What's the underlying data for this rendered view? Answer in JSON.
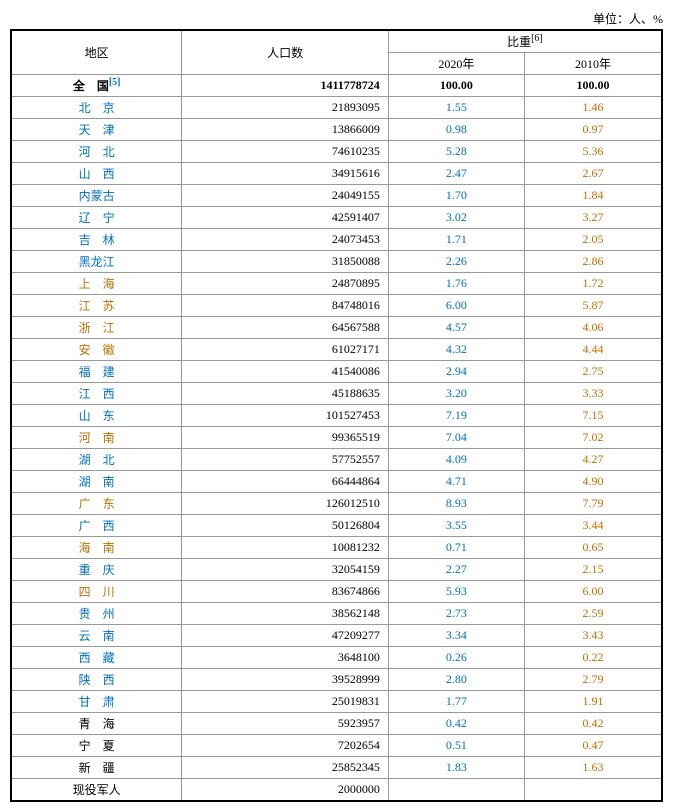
{
  "unit": "单位：人、%",
  "headers": {
    "region": "地区",
    "population": "人口数",
    "ratio_group": "比重",
    "ratio_note": "[6]",
    "year2020": "2020年",
    "year2010": "2010年"
  },
  "rows": [
    {
      "region": "全　国",
      "note": "[5]",
      "population": "1411778724",
      "r2020": "100.00",
      "r2010": "100.00",
      "bold": true
    },
    {
      "region": "北　京",
      "note": "",
      "population": "21893095",
      "r2020": "1.55",
      "r2010": "1.46",
      "bold": false
    },
    {
      "region": "天　津",
      "note": "",
      "population": "13866009",
      "r2020": "0.98",
      "r2010": "0.97",
      "bold": false
    },
    {
      "region": "河　北",
      "note": "",
      "population": "74610235",
      "r2020": "5.28",
      "r2010": "5.36",
      "bold": false
    },
    {
      "region": "山　西",
      "note": "",
      "population": "34915616",
      "r2020": "2.47",
      "r2010": "2.67",
      "bold": false
    },
    {
      "region": "内蒙古",
      "note": "",
      "population": "24049155",
      "r2020": "1.70",
      "r2010": "1.84",
      "bold": false
    },
    {
      "region": "辽　宁",
      "note": "",
      "population": "42591407",
      "r2020": "3.02",
      "r2010": "3.27",
      "bold": false
    },
    {
      "region": "吉　林",
      "note": "",
      "population": "24073453",
      "r2020": "1.71",
      "r2010": "2.05",
      "bold": false
    },
    {
      "region": "黑龙江",
      "note": "",
      "population": "31850088",
      "r2020": "2.26",
      "r2010": "2.86",
      "bold": false
    },
    {
      "region": "上　海",
      "note": "",
      "population": "24870895",
      "r2020": "1.76",
      "r2010": "1.72",
      "bold": false
    },
    {
      "region": "江　苏",
      "note": "",
      "population": "84748016",
      "r2020": "6.00",
      "r2010": "5.87",
      "bold": false
    },
    {
      "region": "浙　江",
      "note": "",
      "population": "64567588",
      "r2020": "4.57",
      "r2010": "4.06",
      "bold": false
    },
    {
      "region": "安　徽",
      "note": "",
      "population": "61027171",
      "r2020": "4.32",
      "r2010": "4.44",
      "bold": false
    },
    {
      "region": "福　建",
      "note": "",
      "population": "41540086",
      "r2020": "2.94",
      "r2010": "2.75",
      "bold": false
    },
    {
      "region": "江　西",
      "note": "",
      "population": "45188635",
      "r2020": "3.20",
      "r2010": "3.33",
      "bold": false
    },
    {
      "region": "山　东",
      "note": "",
      "population": "101527453",
      "r2020": "7.19",
      "r2010": "7.15",
      "bold": false
    },
    {
      "region": "河　南",
      "note": "",
      "population": "99365519",
      "r2020": "7.04",
      "r2010": "7.02",
      "bold": false
    },
    {
      "region": "湖　北",
      "note": "",
      "population": "57752557",
      "r2020": "4.09",
      "r2010": "4.27",
      "bold": false
    },
    {
      "region": "湖　南",
      "note": "",
      "population": "66444864",
      "r2020": "4.71",
      "r2010": "4.90",
      "bold": false
    },
    {
      "region": "广　东",
      "note": "",
      "population": "126012510",
      "r2020": "8.93",
      "r2010": "7.79",
      "bold": false
    },
    {
      "region": "广　西",
      "note": "",
      "population": "50126804",
      "r2020": "3.55",
      "r2010": "3.44",
      "bold": false
    },
    {
      "region": "海　南",
      "note": "",
      "population": "10081232",
      "r2020": "0.71",
      "r2010": "0.65",
      "bold": false
    },
    {
      "region": "重　庆",
      "note": "",
      "population": "32054159",
      "r2020": "2.27",
      "r2010": "2.15",
      "bold": false
    },
    {
      "region": "四　川",
      "note": "",
      "population": "83674866",
      "r2020": "5.93",
      "r2010": "6.00",
      "bold": false
    },
    {
      "region": "贵　州",
      "note": "",
      "population": "38562148",
      "r2020": "2.73",
      "r2010": "2.59",
      "bold": false
    },
    {
      "region": "云　南",
      "note": "",
      "population": "47209277",
      "r2020": "3.34",
      "r2010": "3.43",
      "bold": false
    },
    {
      "region": "西　藏",
      "note": "",
      "population": "3648100",
      "r2020": "0.26",
      "r2010": "0.22",
      "bold": false
    },
    {
      "region": "陕　西",
      "note": "",
      "population": "39528999",
      "r2020": "2.80",
      "r2010": "2.79",
      "bold": false
    },
    {
      "region": "甘　肃",
      "note": "",
      "population": "25019831",
      "r2020": "1.77",
      "r2010": "1.91",
      "bold": false
    },
    {
      "region": "青　海",
      "note": "",
      "population": "5923957",
      "r2020": "0.42",
      "r2010": "0.42",
      "bold": false
    },
    {
      "region": "宁　夏",
      "note": "",
      "population": "7202654",
      "r2020": "0.51",
      "r2010": "0.47",
      "bold": false
    },
    {
      "region": "新　疆",
      "note": "",
      "population": "25852345",
      "r2020": "1.83",
      "r2010": "1.63",
      "bold": false
    },
    {
      "region": "现役军人",
      "note": "",
      "population": "2000000",
      "r2020": "",
      "r2010": "",
      "bold": false
    }
  ]
}
